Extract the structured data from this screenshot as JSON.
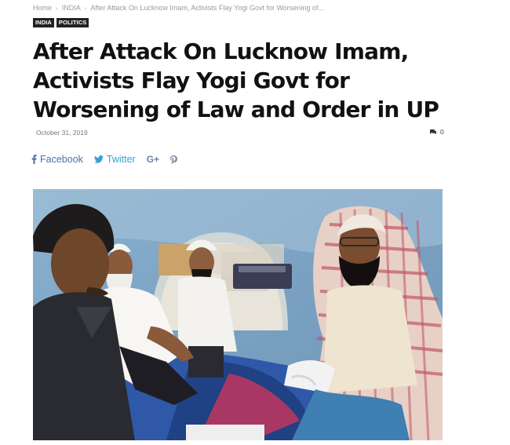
{
  "breadcrumb": {
    "home": "Home",
    "category": "INDIA",
    "current": "After Attack On Lucknow Imam, Activists Flay Yogi Govt for Worsening of..."
  },
  "categories": [
    "INDIA",
    "POLITICS"
  ],
  "article": {
    "title": "After Attack On Lucknow Imam, Activists Flay Yogi Govt for Worsening of Law and Order in UP",
    "date": "October 31, 2019",
    "comment_count": "0"
  },
  "share": {
    "facebook": "Facebook",
    "twitter": "Twitter",
    "googleplus": "G+"
  },
  "icons": {
    "facebook": "facebook-icon",
    "twitter": "twitter-icon",
    "googleplus": "google-plus-icon",
    "pinterest": "pinterest-icon",
    "comments": "comment-icon"
  },
  "colors": {
    "facebook": "#516eab",
    "twitter": "#3a9fd9",
    "category_bg": "#222222"
  }
}
